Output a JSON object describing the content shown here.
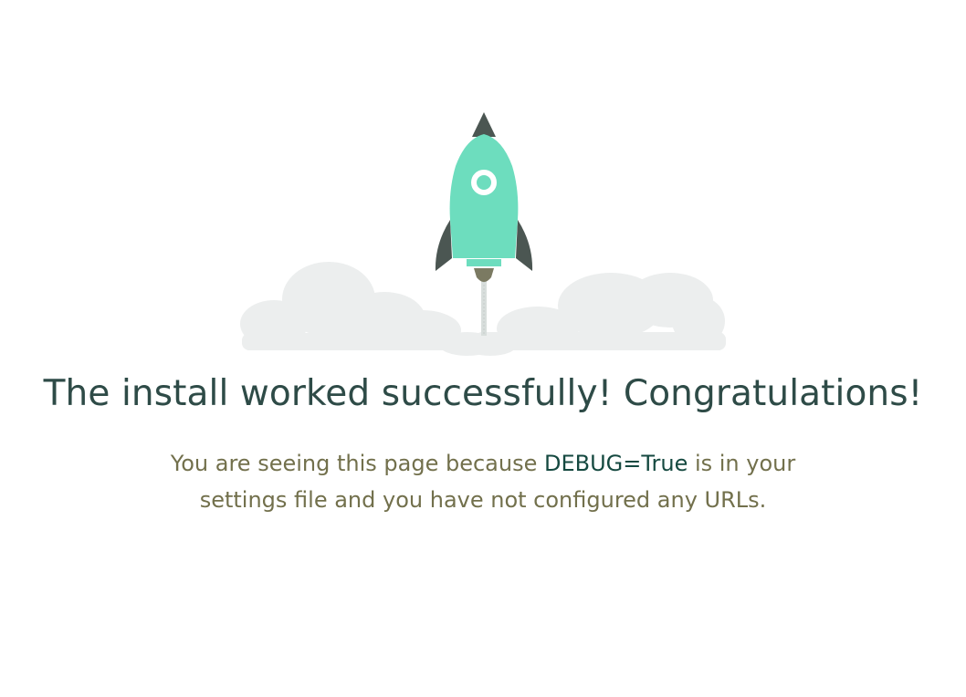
{
  "page": {
    "title": "The install worked successfully! Congratulations!",
    "message_before": "You are seeing this page because ",
    "debug_setting": "DEBUG=True",
    "message_after": " is in your settings file and you have not configured any URLs."
  },
  "illustration": {
    "icon": "rocket-launch-icon",
    "colors": {
      "rocket_body": "#6dddbe",
      "rocket_dark": "#4b5652",
      "exhaust": "#7b7a62",
      "clouds": "#eceeee"
    }
  }
}
